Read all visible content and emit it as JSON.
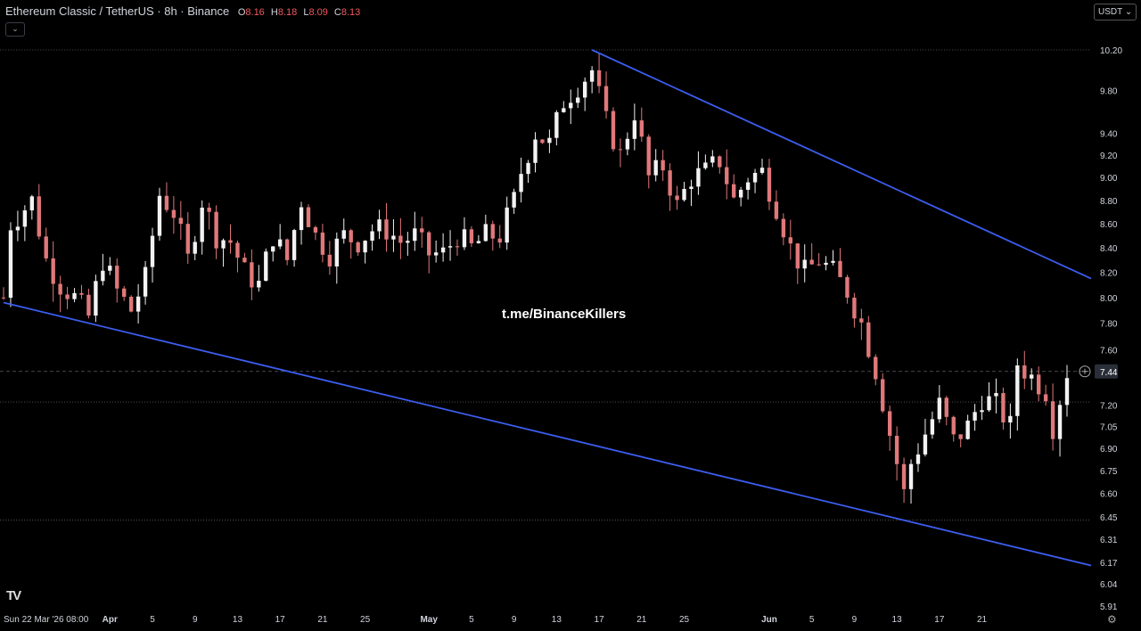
{
  "header": {
    "title": "Ethereum Classic / TetherUS · 8h · Binance",
    "ohlc": [
      {
        "k": "O",
        "v": "8.16"
      },
      {
        "k": "H",
        "v": "8.18"
      },
      {
        "k": "L",
        "v": "8.09"
      },
      {
        "k": "C",
        "v": "8.13"
      }
    ],
    "collapse_icon": "chevron-down-icon"
  },
  "currency_label": "USDT ⌄",
  "watermark": "t.me/BinanceKillers",
  "logo": "TV",
  "colors": {
    "background": "#000000",
    "up": "#f2f2f2",
    "down": "#e0787a",
    "trendline": "#3d5df0",
    "text": "#d1d4dc"
  },
  "chart_data": {
    "type": "candlestick",
    "symbol": "Ethereum Classic / TetherUS",
    "interval": "8h",
    "exchange": "Binance",
    "scale": "log",
    "ylim": [
      5.91,
      10.5
    ],
    "y_ticks": [
      "10.20",
      "9.80",
      "9.40",
      "9.20",
      "9.00",
      "8.80",
      "8.60",
      "8.40",
      "8.20",
      "8.00",
      "7.80",
      "7.60",
      "7.20",
      "7.05",
      "6.90",
      "6.75",
      "6.60",
      "6.45",
      "6.31",
      "6.17",
      "6.04",
      "5.91"
    ],
    "x_ticks": [
      "Sun 22 Mar '26   08:00",
      "Apr",
      "5",
      "9",
      "13",
      "17",
      "21",
      "25",
      "May",
      "5",
      "9",
      "13",
      "17",
      "21",
      "25",
      "Jun",
      "5",
      "9",
      "13",
      "17",
      "21"
    ],
    "current_price": "7.44",
    "horizontal_levels": [
      10.2,
      7.44,
      7.22,
      6.43
    ],
    "trendlines": [
      {
        "name": "upper",
        "from": {
          "bar": 83,
          "price": 10.2
        },
        "to": {
          "bar": 150,
          "price": 8.15
        }
      },
      {
        "name": "lower",
        "from": {
          "bar": 0,
          "price": 7.96
        },
        "to": {
          "bar": 150,
          "price": 6.15
        }
      }
    ],
    "keypoints": [
      [
        0,
        8.0
      ],
      [
        1,
        8.6
      ],
      [
        4,
        8.8
      ],
      [
        6,
        8.3
      ],
      [
        8,
        8.1
      ],
      [
        10,
        8.0
      ],
      [
        12,
        7.85
      ],
      [
        14,
        8.3
      ],
      [
        16,
        8.05
      ],
      [
        18,
        7.9
      ],
      [
        20,
        8.15
      ],
      [
        22,
        8.85
      ],
      [
        24,
        8.7
      ],
      [
        26,
        8.3
      ],
      [
        28,
        8.8
      ],
      [
        30,
        8.5
      ],
      [
        32,
        8.45
      ],
      [
        34,
        8.2
      ],
      [
        36,
        8.1
      ],
      [
        38,
        8.5
      ],
      [
        40,
        8.3
      ],
      [
        42,
        8.8
      ],
      [
        44,
        8.5
      ],
      [
        46,
        8.35
      ],
      [
        48,
        8.5
      ],
      [
        50,
        8.45
      ],
      [
        52,
        8.55
      ],
      [
        54,
        8.55
      ],
      [
        56,
        8.45
      ],
      [
        58,
        8.5
      ],
      [
        60,
        8.35
      ],
      [
        62,
        8.35
      ],
      [
        64,
        8.5
      ],
      [
        66,
        8.4
      ],
      [
        68,
        8.5
      ],
      [
        70,
        8.5
      ],
      [
        72,
        8.8
      ],
      [
        73,
        9.05
      ],
      [
        75,
        9.4
      ],
      [
        77,
        9.3
      ],
      [
        79,
        9.7
      ],
      [
        81,
        9.85
      ],
      [
        83,
        10.0
      ],
      [
        85,
        9.5
      ],
      [
        87,
        9.2
      ],
      [
        89,
        9.6
      ],
      [
        91,
        9.0
      ],
      [
        93,
        9.1
      ],
      [
        95,
        8.75
      ],
      [
        97,
        9.0
      ],
      [
        99,
        9.05
      ],
      [
        101,
        9.15
      ],
      [
        103,
        8.8
      ],
      [
        105,
        9.0
      ],
      [
        107,
        9.05
      ],
      [
        109,
        8.75
      ],
      [
        111,
        8.4
      ],
      [
        113,
        8.2
      ],
      [
        115,
        8.3
      ],
      [
        117,
        8.2
      ],
      [
        119,
        8.05
      ],
      [
        121,
        7.8
      ],
      [
        123,
        7.45
      ],
      [
        125,
        7.0
      ],
      [
        127,
        6.6
      ],
      [
        128,
        6.8
      ],
      [
        130,
        7.0
      ],
      [
        132,
        7.2
      ],
      [
        134,
        6.95
      ],
      [
        136,
        7.05
      ],
      [
        138,
        7.25
      ],
      [
        140,
        7.2
      ],
      [
        142,
        7.05
      ],
      [
        143,
        7.5
      ],
      [
        145,
        7.4
      ],
      [
        147,
        7.3
      ],
      [
        148,
        7.05
      ],
      [
        150,
        7.44
      ]
    ]
  }
}
